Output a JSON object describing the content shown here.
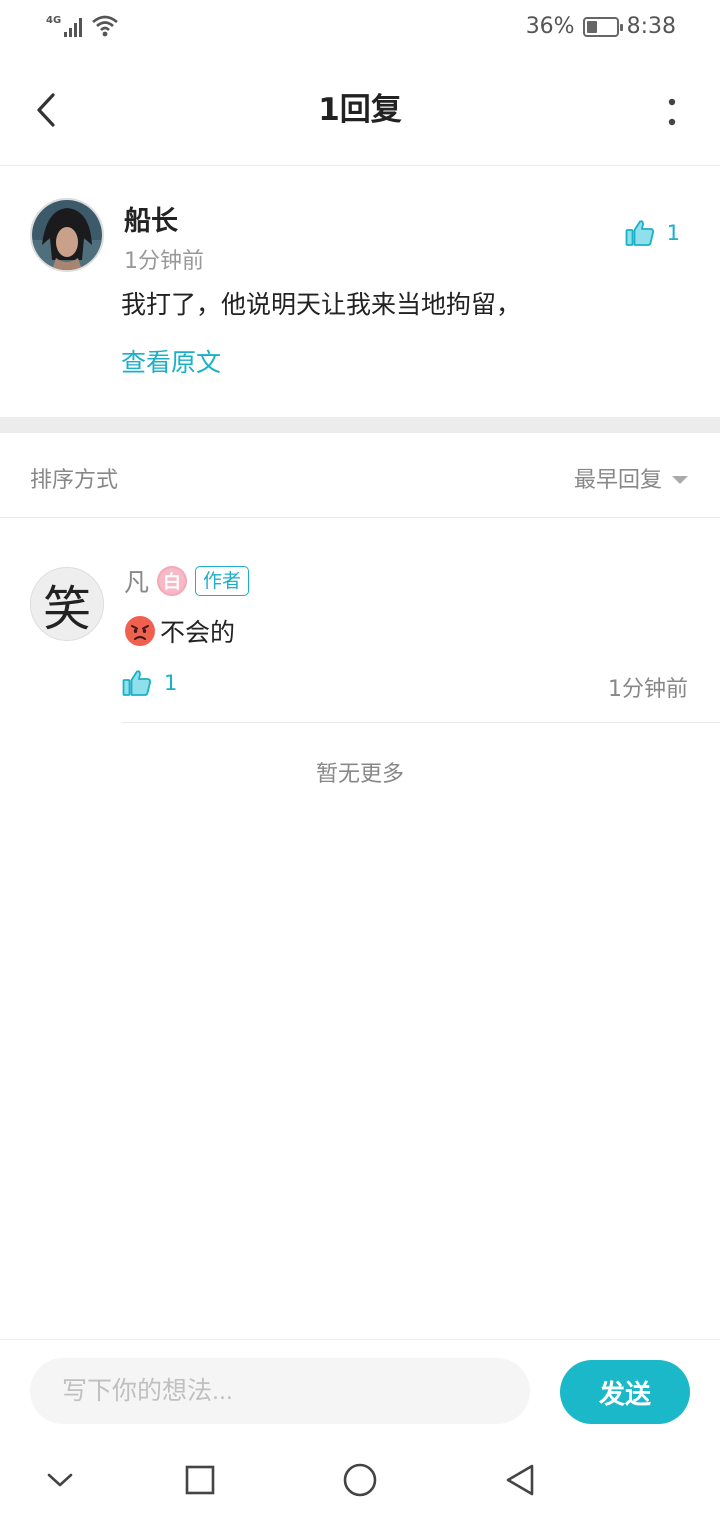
{
  "status_bar": {
    "network": "4G",
    "battery_percent": "36%",
    "battery_level": 0.36,
    "time": "8:38"
  },
  "header": {
    "title": "1回复"
  },
  "original_comment": {
    "author": "船长",
    "time": "1分钟前",
    "text": "我打了，他说明天让我来当地拘留，",
    "view_original": "查看原文",
    "likes": "1"
  },
  "sort": {
    "label": "排序方式",
    "value": "最早回复"
  },
  "replies": [
    {
      "author": "凡",
      "avatar_char": "笑",
      "level_badge": "白",
      "author_tag": "作者",
      "text": "不会的",
      "emoji": "angry-face",
      "likes": "1",
      "time": "1分钟前"
    }
  ],
  "no_more": "暂无更多",
  "input": {
    "placeholder": "写下你的想法...",
    "send_label": "发送"
  },
  "colors": {
    "accent": "#1ab0c8",
    "send_button": "#1ab8c8",
    "badge_pink": "#f7b9c6"
  }
}
